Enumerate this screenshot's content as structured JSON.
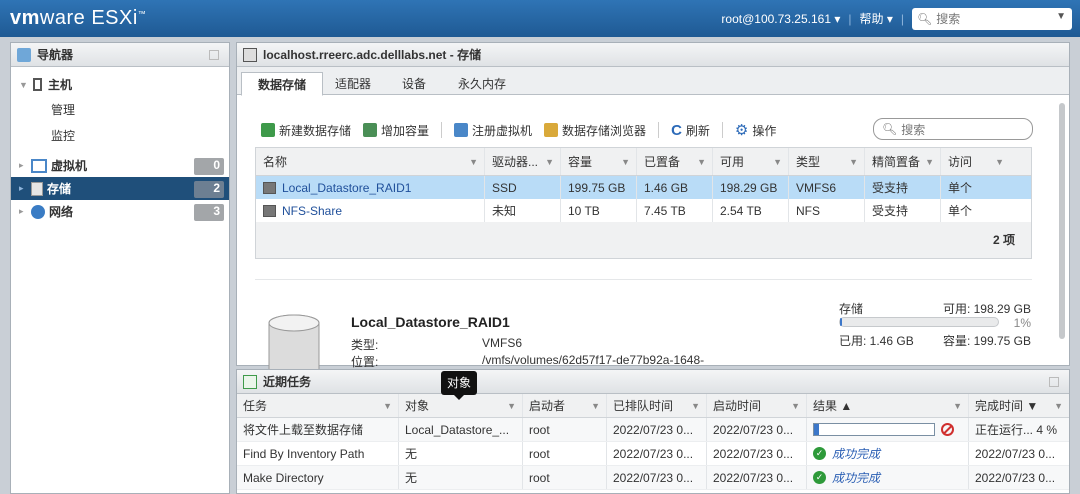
{
  "topbar": {
    "logo_vm": "vm",
    "logo_ware": "ware",
    "logo_product": "ESXi",
    "logo_tm": "™",
    "user": "root@100.73.25.161",
    "help": "帮助",
    "search_placeholder": "搜索"
  },
  "navigator": {
    "title": "导航器",
    "host": {
      "label": "主机",
      "children": [
        "管理",
        "监控"
      ]
    },
    "items": [
      {
        "label": "虚拟机",
        "count": "0"
      },
      {
        "label": "存储",
        "count": "2"
      },
      {
        "label": "网络",
        "count": "3"
      }
    ]
  },
  "main": {
    "title": "localhost.rreerc.adc.delllabs.net - 存储",
    "tabs": [
      "数据存储",
      "适配器",
      "设备",
      "永久内存"
    ],
    "toolbar": {
      "new_datastore": "新建数据存储",
      "increase_capacity": "增加容量",
      "register_vm": "注册虚拟机",
      "datastore_browser": "数据存储浏览器",
      "refresh": "刷新",
      "actions": "操作"
    },
    "search_placeholder": "搜索",
    "grid": {
      "columns": [
        "名称",
        "驱动器...",
        "容量",
        "已置备",
        "可用",
        "类型",
        "精简置备",
        "访问"
      ],
      "rows": [
        [
          "Local_Datastore_RAID1",
          "SSD",
          "199.75 GB",
          "1.46 GB",
          "198.29 GB",
          "VMFS6",
          "受支持",
          "单个"
        ],
        [
          "NFS-Share",
          "未知",
          "10 TB",
          "7.45 TB",
          "2.54 TB",
          "NFS",
          "受支持",
          "单个"
        ]
      ],
      "count": "2 项"
    },
    "detail": {
      "name": "Local_Datastore_RAID1",
      "type_label": "类型:",
      "type_value": "VMFS6",
      "location_label": "位置:",
      "location_value": "/vmfs/volumes/62d57f17-de77b92a-1648-",
      "storage_label": "存储",
      "free": "可用: 198.29 GB",
      "percent": "1%",
      "percent_value": 0.01,
      "used": "已用: 1.46 GB",
      "capacity": "容量: 199.75 GB"
    }
  },
  "tasks": {
    "title": "近期任务",
    "tooltip": "对象",
    "columns": [
      "任务",
      "对象",
      "启动者",
      "已排队时间",
      "启动时间",
      "结果 ▲",
      "完成时间 ▼"
    ],
    "rows": [
      {
        "task": "将文件上载至数据存储",
        "object": "Local_Datastore_...",
        "initiator": "root",
        "queued": "2022/07/23 0...",
        "started": "2022/07/23 0...",
        "result": "",
        "progress": 0.04,
        "completed": "正在运行... 4 %"
      },
      {
        "task": "Find By Inventory Path",
        "object": "无",
        "initiator": "root",
        "queued": "2022/07/23 0...",
        "started": "2022/07/23 0...",
        "result": "成功完成",
        "completed": "2022/07/23 0..."
      },
      {
        "task": "Make Directory",
        "object": "无",
        "initiator": "root",
        "queued": "2022/07/23 0...",
        "started": "2022/07/23 0...",
        "result": "成功完成",
        "completed": "2022/07/23 0..."
      }
    ]
  },
  "colors": {
    "topbar": "#2f74b5",
    "selected_nav": "#1f4f7a",
    "selected_row": "#b9dcf7",
    "success": "#2e9a3a"
  }
}
